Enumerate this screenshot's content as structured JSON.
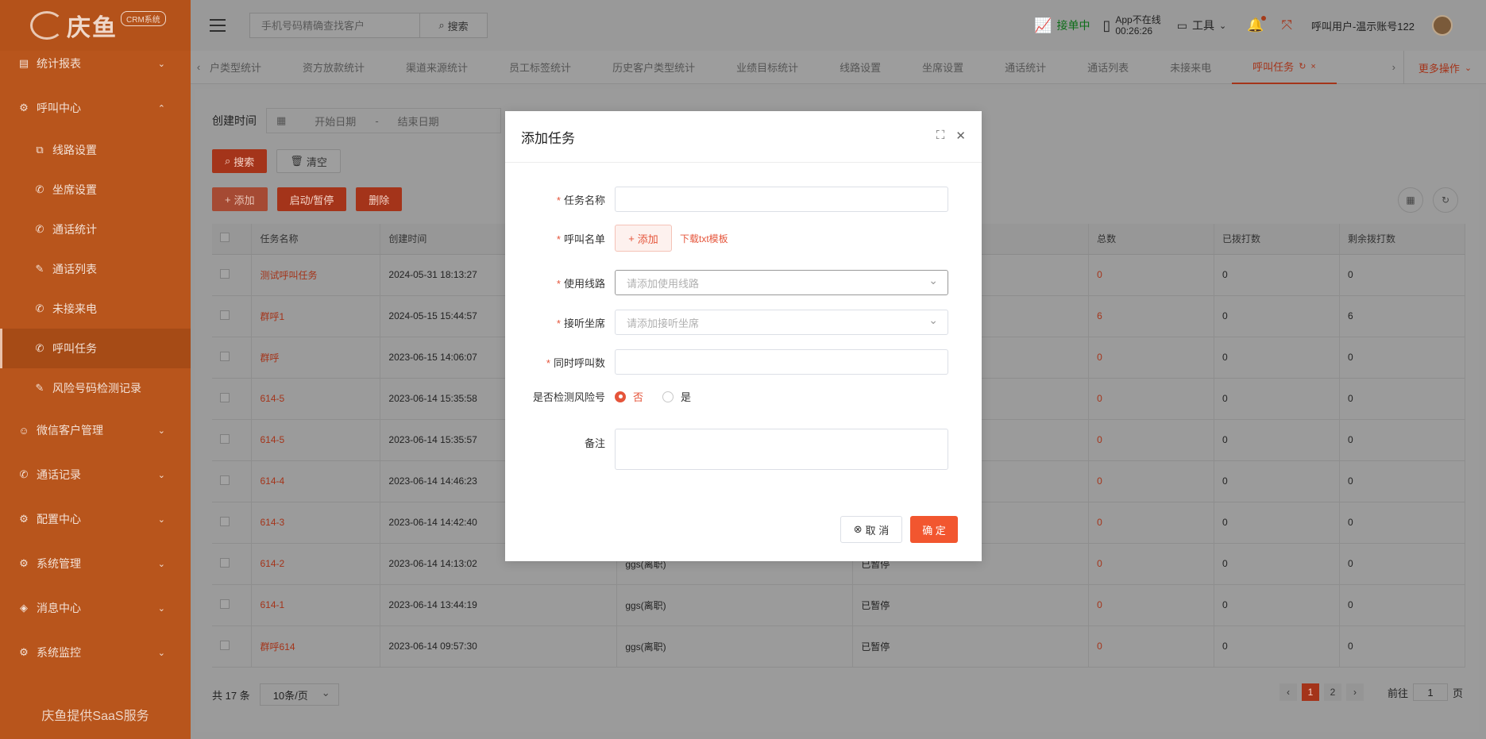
{
  "brand": {
    "name": "庆鱼",
    "badge": "CRM系统"
  },
  "sidebar": {
    "items": [
      {
        "label": "统计报表",
        "icon": "chart-icon",
        "expanded": false
      },
      {
        "label": "呼叫中心",
        "icon": "settings-icon",
        "expanded": true,
        "children": [
          {
            "label": "线路设置",
            "icon": "network-icon"
          },
          {
            "label": "坐席设置",
            "icon": "phone-icon"
          },
          {
            "label": "通话统计",
            "icon": "phone-call-icon"
          },
          {
            "label": "通话列表",
            "icon": "edit-icon"
          },
          {
            "label": "未接来电",
            "icon": "phone-missed-icon"
          },
          {
            "label": "呼叫任务",
            "icon": "phone-icon",
            "active": true
          },
          {
            "label": "风险号码检测记录",
            "icon": "edit-icon"
          }
        ]
      },
      {
        "label": "微信客户管理",
        "icon": "users-icon",
        "expanded": false
      },
      {
        "label": "通话记录",
        "icon": "phone-call-icon",
        "expanded": false
      },
      {
        "label": "配置中心",
        "icon": "settings-icon",
        "expanded": false
      },
      {
        "label": "系统管理",
        "icon": "settings-icon",
        "expanded": false
      },
      {
        "label": "消息中心",
        "icon": "tag-icon",
        "expanded": false
      },
      {
        "label": "系统监控",
        "icon": "settings-icon",
        "expanded": false
      }
    ],
    "footer": "庆鱼提供SaaS服务"
  },
  "header": {
    "search_placeholder": "手机号码精确查找客户",
    "search_button": "搜索",
    "accepting": "接单中",
    "app_status_line1": "App不在线",
    "app_status_line2": "00:26:26",
    "tools": "工具",
    "username": "呼叫用户-温示账号122"
  },
  "tabs": [
    {
      "label": "户类型统计"
    },
    {
      "label": "资方放款统计"
    },
    {
      "label": "渠道来源统计"
    },
    {
      "label": "员工标签统计"
    },
    {
      "label": "历史客户类型统计"
    },
    {
      "label": "业绩目标统计"
    },
    {
      "label": "线路设置"
    },
    {
      "label": "坐席设置"
    },
    {
      "label": "通话统计"
    },
    {
      "label": "通话列表"
    },
    {
      "label": "未接来电"
    },
    {
      "label": "呼叫任务",
      "active": true
    }
  ],
  "more_ops": "更多操作",
  "filter": {
    "label": "创建时间",
    "start_placeholder": "开始日期",
    "separator": "-",
    "end_placeholder": "结束日期"
  },
  "buttons": {
    "search": "搜索",
    "clear": "清空",
    "add": "添加",
    "toggle": "启动/暂停",
    "delete": "删除"
  },
  "table": {
    "headers": [
      "任务名称",
      "创建时间",
      "",
      "",
      "总数",
      "已拨打数",
      "剩余拨打数"
    ],
    "rows": [
      [
        "测试呼叫任务",
        "2024-05-31 18:13:27",
        "",
        "",
        "0",
        "0",
        "0"
      ],
      [
        "群呼1",
        "2024-05-15 15:44:57",
        "",
        "",
        "6",
        "0",
        "6"
      ],
      [
        "群呼",
        "2023-06-15 14:06:07",
        "",
        "",
        "0",
        "0",
        "0"
      ],
      [
        "614-5",
        "2023-06-14 15:35:58",
        "",
        "",
        "0",
        "0",
        "0"
      ],
      [
        "614-5",
        "2023-06-14 15:35:57",
        "",
        "",
        "0",
        "0",
        "0"
      ],
      [
        "614-4",
        "2023-06-14 14:46:23",
        "",
        "",
        "0",
        "0",
        "0"
      ],
      [
        "614-3",
        "2023-06-14 14:42:40",
        "",
        "",
        "0",
        "0",
        "0"
      ],
      [
        "614-2",
        "2023-06-14 14:13:02",
        "ggs(离职)",
        "已暂停",
        "0",
        "0",
        "0"
      ],
      [
        "614-1",
        "2023-06-14 13:44:19",
        "ggs(离职)",
        "已暂停",
        "0",
        "0",
        "0"
      ],
      [
        "群呼614",
        "2023-06-14 09:57:30",
        "ggs(离职)",
        "已暂停",
        "0",
        "0",
        "0"
      ]
    ]
  },
  "pagination": {
    "total": "共 17 条",
    "page_size": "10条/页",
    "pages": [
      "1",
      "2"
    ],
    "current": "1",
    "goto_label": "前往",
    "goto_value": "1",
    "page_unit": "页"
  },
  "modal": {
    "title": "添加任务",
    "fields": {
      "task_name": {
        "label": "任务名称",
        "value": ""
      },
      "call_list": {
        "label": "呼叫名单",
        "add_button": "添加",
        "download_link": "下载txt模板"
      },
      "line": {
        "label": "使用线路",
        "placeholder": "请添加使用线路"
      },
      "seat": {
        "label": "接听坐席",
        "placeholder": "请添加接听坐席"
      },
      "concurrency": {
        "label": "同时呼叫数",
        "value": ""
      },
      "risk_check": {
        "label": "是否检测风险号",
        "options": [
          "否",
          "是"
        ],
        "selected": "否"
      },
      "remark": {
        "label": "备注",
        "value": ""
      }
    },
    "cancel": "取 消",
    "confirm": "确 定"
  },
  "colors": {
    "brand": "#f2562f",
    "sidebar": "#b8551c"
  }
}
